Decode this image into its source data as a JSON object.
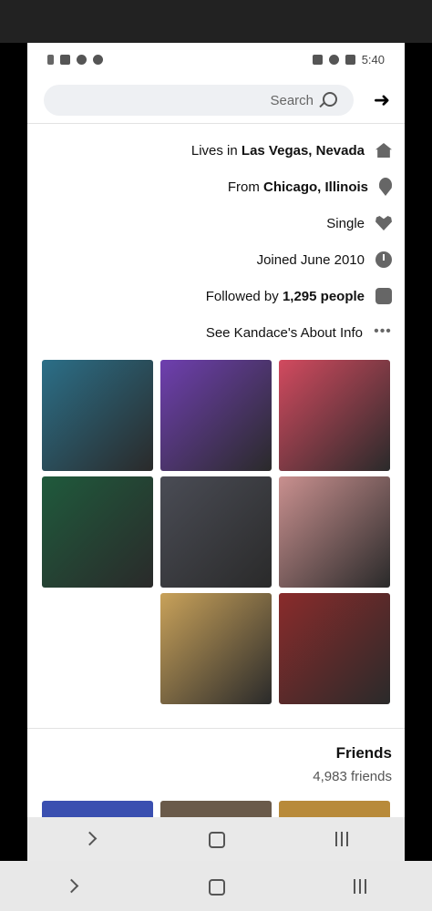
{
  "status": {
    "time": "5:40"
  },
  "search": {
    "placeholder": "Search"
  },
  "about": [
    {
      "icon": "home-icon",
      "prefix": "Lives in ",
      "bold": "Las Vegas, Nevada"
    },
    {
      "icon": "location-pin-icon",
      "prefix": "From ",
      "bold": "Chicago, Illinois"
    },
    {
      "icon": "heart-icon",
      "prefix": "Single",
      "bold": ""
    },
    {
      "icon": "clock-icon",
      "prefix": "Joined June 2010",
      "bold": ""
    },
    {
      "icon": "rss-icon",
      "prefix": "Followed by ",
      "bold": "1,295 people"
    },
    {
      "icon": "more-dots-icon",
      "prefix": "See Kandace's About Info",
      "bold": ""
    }
  ],
  "friends": {
    "title": "Friends",
    "count": "4,983 friends"
  },
  "colors": {
    "photo_1": "#2b6f88",
    "photo_2": "#6f3fb0",
    "photo_3": "#d24a5f",
    "photo_4": "#1f5a3c",
    "photo_5": "#4a4c55",
    "photo_6": "#c9908f",
    "photo_7": "#c9a25a",
    "photo_8": "#8a2b2b",
    "friend_1": "#3a4fb0",
    "friend_2": "#6a5a4a",
    "friend_3": "#b88a3a"
  }
}
